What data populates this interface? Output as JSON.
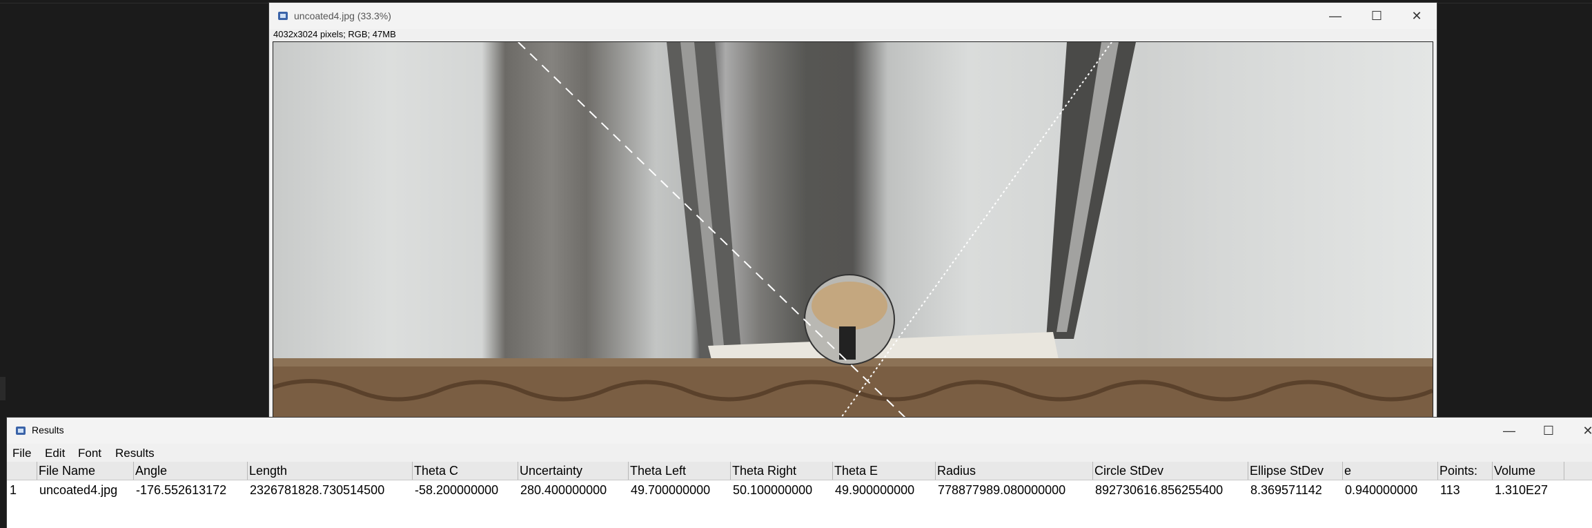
{
  "image_window": {
    "title": "uncoated4.jpg (33.3%)",
    "info": "4032x3024 pixels; RGB; 47MB",
    "controls": {
      "minimize": "—",
      "maximize": "☐",
      "close": "✕"
    }
  },
  "results_window": {
    "title": "Results",
    "controls": {
      "minimize": "—",
      "maximize": "☐",
      "close": "✕"
    },
    "menu": [
      "File",
      "Edit",
      "Font",
      "Results"
    ],
    "columns": [
      "",
      "File Name",
      "Angle",
      "Length",
      "Theta C",
      "Uncertainty",
      "Theta Left",
      "Theta Right",
      "Theta E",
      "Radius",
      "Circle StDev",
      "Ellipse StDev",
      "e",
      "Points:",
      "Volume"
    ],
    "rows": [
      [
        "1",
        "uncoated4.jpg",
        "-176.552613172",
        "2326781828.730514500",
        "-58.200000000",
        "280.400000000",
        "49.700000000",
        "50.100000000",
        "49.900000000",
        "778877989.080000000",
        "892730616.856255400",
        "8.369571142",
        "0.940000000",
        "113",
        "1.310E27"
      ]
    ]
  },
  "colors": {
    "desktop": "#1b1b1b",
    "window": "#f3f3f3",
    "header": "#e8e8e8",
    "icon": "#3a63a8"
  }
}
